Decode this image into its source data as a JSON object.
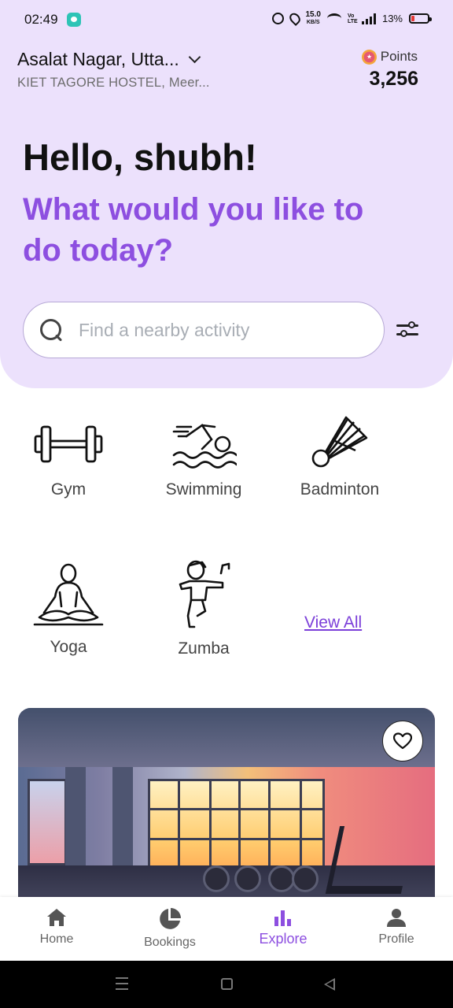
{
  "status_bar": {
    "time": "02:49",
    "net_speed_top": "15.0",
    "net_speed_unit": "KB/S",
    "network_label": "Vo LTE",
    "battery": "13%"
  },
  "header": {
    "location_title": "Asalat Nagar, Utta...",
    "location_subtitle": "KIET TAGORE HOSTEL, Meer...",
    "points_label": "Points",
    "points_value": "3,256"
  },
  "hero": {
    "greeting": "Hello, shubh!",
    "question": "What would you like to do today?"
  },
  "search": {
    "placeholder": "Find a nearby activity",
    "value": ""
  },
  "categories": [
    {
      "label": "Gym",
      "icon": "dumbbell-icon"
    },
    {
      "label": "Swimming",
      "icon": "swimmer-icon"
    },
    {
      "label": "Badminton",
      "icon": "shuttlecock-icon"
    },
    {
      "label": "Yoga",
      "icon": "yoga-icon"
    },
    {
      "label": "Zumba",
      "icon": "dancer-icon"
    }
  ],
  "view_all_label": "View All",
  "bottom_nav": {
    "items": [
      {
        "label": "Home",
        "icon": "home-icon"
      },
      {
        "label": "Bookings",
        "icon": "pie-chart-icon"
      },
      {
        "label": "Explore",
        "icon": "bar-chart-icon"
      },
      {
        "label": "Profile",
        "icon": "person-icon"
      }
    ],
    "active": "Explore"
  },
  "colors": {
    "accent": "#8d4fe0",
    "header_bg": "#ece1fc",
    "link": "#7b3fd9"
  }
}
